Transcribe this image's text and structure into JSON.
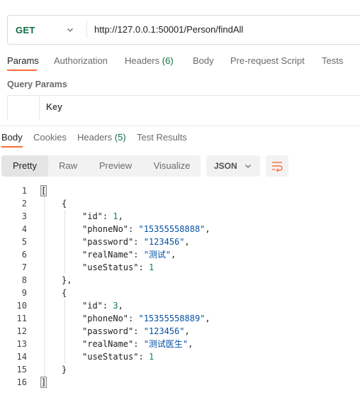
{
  "request": {
    "method": "GET",
    "url": "http://127.0.0.1:50001/Person/findAll"
  },
  "request_tabs": [
    {
      "label": "Params",
      "active": true
    },
    {
      "label": "Authorization"
    },
    {
      "label": "Headers",
      "count": "(6)"
    },
    {
      "label": "Body"
    },
    {
      "label": "Pre-request Script"
    },
    {
      "label": "Tests"
    }
  ],
  "query_params": {
    "title": "Query Params",
    "key_header": "Key"
  },
  "response_tabs": [
    {
      "label": "Body",
      "active": true
    },
    {
      "label": "Cookies"
    },
    {
      "label": "Headers",
      "count": "(5)"
    },
    {
      "label": "Test Results"
    }
  ],
  "view_modes": [
    "Pretty",
    "Raw",
    "Preview",
    "Visualize"
  ],
  "active_view": "Pretty",
  "format": "JSON",
  "colors": {
    "accent": "#ff6c37",
    "method_get": "#0b6e41",
    "json_string": "#0451a5",
    "json_number": "#098658"
  },
  "icons": {
    "method_dropdown": "chevron-down-icon",
    "format_dropdown": "chevron-down-icon",
    "wrap": "wrap-lines-icon"
  },
  "response_body": [
    {
      "n": "1",
      "indent": 0,
      "tokens": [
        {
          "t": "[",
          "c": "p",
          "hl": true
        }
      ]
    },
    {
      "n": "2",
      "indent": 1,
      "tokens": [
        {
          "t": "{",
          "c": "p"
        }
      ]
    },
    {
      "n": "3",
      "indent": 2,
      "tokens": [
        {
          "t": "\"id\"",
          "c": "k"
        },
        {
          "t": ": ",
          "c": "p"
        },
        {
          "t": "1",
          "c": "n"
        },
        {
          "t": ",",
          "c": "p"
        }
      ]
    },
    {
      "n": "4",
      "indent": 2,
      "tokens": [
        {
          "t": "\"phoneNo\"",
          "c": "k"
        },
        {
          "t": ": ",
          "c": "p"
        },
        {
          "t": "\"15355558888\"",
          "c": "s"
        },
        {
          "t": ",",
          "c": "p"
        }
      ]
    },
    {
      "n": "5",
      "indent": 2,
      "tokens": [
        {
          "t": "\"password\"",
          "c": "k"
        },
        {
          "t": ": ",
          "c": "p"
        },
        {
          "t": "\"123456\"",
          "c": "s"
        },
        {
          "t": ",",
          "c": "p"
        }
      ]
    },
    {
      "n": "6",
      "indent": 2,
      "tokens": [
        {
          "t": "\"realName\"",
          "c": "k"
        },
        {
          "t": ": ",
          "c": "p"
        },
        {
          "t": "\"测试\"",
          "c": "s"
        },
        {
          "t": ",",
          "c": "p"
        }
      ]
    },
    {
      "n": "7",
      "indent": 2,
      "tokens": [
        {
          "t": "\"useStatus\"",
          "c": "k"
        },
        {
          "t": ": ",
          "c": "p"
        },
        {
          "t": "1",
          "c": "n"
        }
      ]
    },
    {
      "n": "8",
      "indent": 1,
      "tokens": [
        {
          "t": "},",
          "c": "p"
        }
      ]
    },
    {
      "n": "9",
      "indent": 1,
      "tokens": [
        {
          "t": "{",
          "c": "p"
        }
      ]
    },
    {
      "n": "10",
      "indent": 2,
      "tokens": [
        {
          "t": "\"id\"",
          "c": "k"
        },
        {
          "t": ": ",
          "c": "p"
        },
        {
          "t": "3",
          "c": "n"
        },
        {
          "t": ",",
          "c": "p"
        }
      ]
    },
    {
      "n": "11",
      "indent": 2,
      "tokens": [
        {
          "t": "\"phoneNo\"",
          "c": "k"
        },
        {
          "t": ": ",
          "c": "p"
        },
        {
          "t": "\"15355558889\"",
          "c": "s"
        },
        {
          "t": ",",
          "c": "p"
        }
      ]
    },
    {
      "n": "12",
      "indent": 2,
      "tokens": [
        {
          "t": "\"password\"",
          "c": "k"
        },
        {
          "t": ": ",
          "c": "p"
        },
        {
          "t": "\"123456\"",
          "c": "s"
        },
        {
          "t": ",",
          "c": "p"
        }
      ]
    },
    {
      "n": "13",
      "indent": 2,
      "tokens": [
        {
          "t": "\"realName\"",
          "c": "k"
        },
        {
          "t": ": ",
          "c": "p"
        },
        {
          "t": "\"测试医生\"",
          "c": "s"
        },
        {
          "t": ",",
          "c": "p"
        }
      ]
    },
    {
      "n": "14",
      "indent": 2,
      "tokens": [
        {
          "t": "\"useStatus\"",
          "c": "k"
        },
        {
          "t": ": ",
          "c": "p"
        },
        {
          "t": "1",
          "c": "n"
        }
      ]
    },
    {
      "n": "15",
      "indent": 1,
      "tokens": [
        {
          "t": "}",
          "c": "p"
        }
      ]
    },
    {
      "n": "16",
      "indent": 0,
      "tokens": [
        {
          "t": "]",
          "c": "p",
          "hl": true
        }
      ]
    }
  ]
}
